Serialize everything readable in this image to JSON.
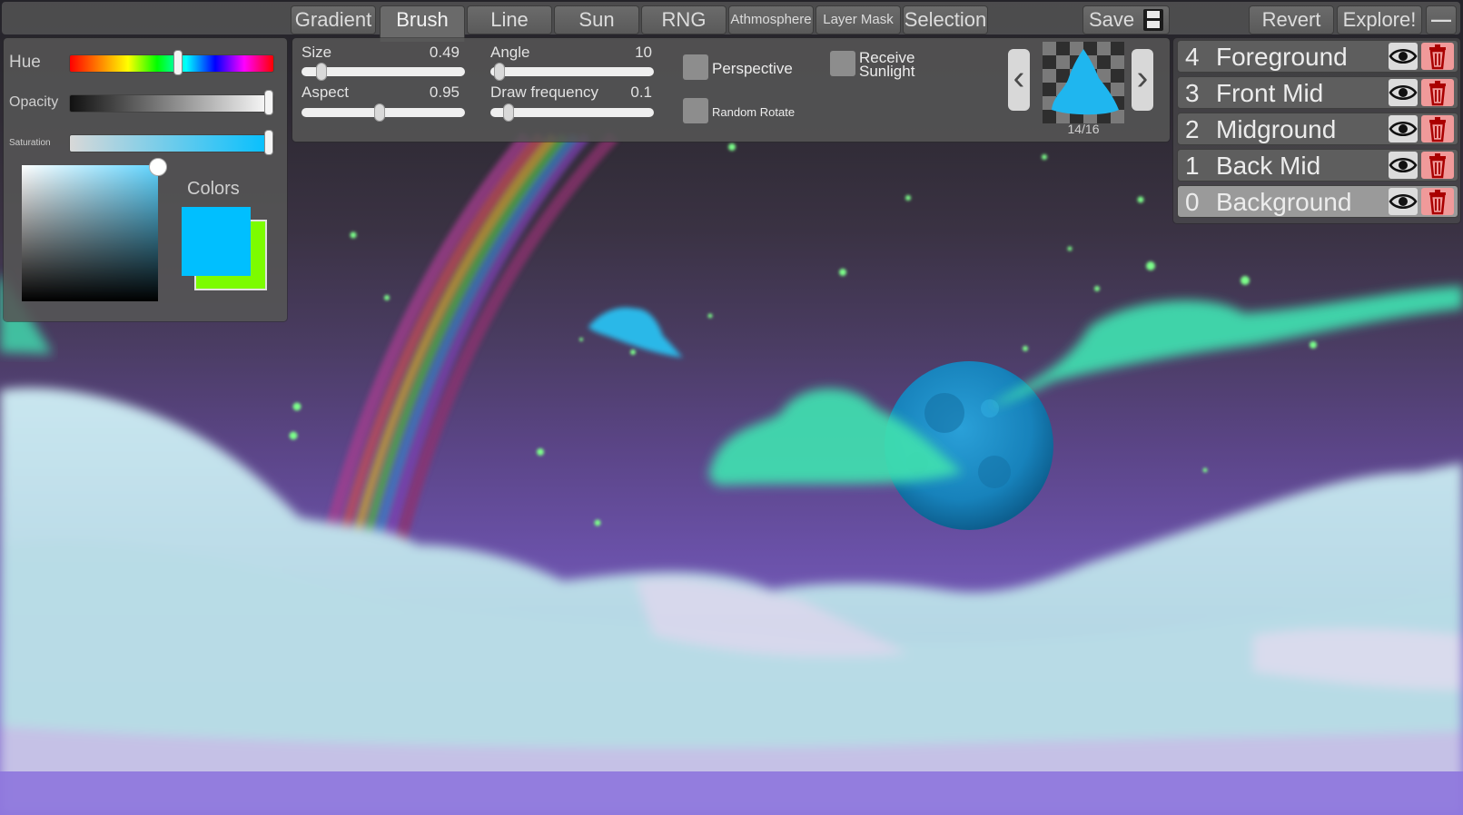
{
  "toolbar": {
    "tabs": [
      {
        "label": "Gradient"
      },
      {
        "label": "Brush"
      },
      {
        "label": "Line"
      },
      {
        "label": "Sun"
      },
      {
        "label": "RNG"
      },
      {
        "label": "Athmosphere"
      },
      {
        "label": "Layer Mask"
      },
      {
        "label": "Selection"
      }
    ],
    "save_label": "Save",
    "revert_label": "Revert",
    "explore_label": "Explore!",
    "minimize_label": "—"
  },
  "brush": {
    "size_label": "Size",
    "size_value": "0.49",
    "angle_label": "Angle",
    "angle_value": "10",
    "aspect_label": "Aspect",
    "aspect_value": "0.95",
    "freq_label": "Draw frequency",
    "freq_value": "0.1",
    "perspective_label": "Perspective",
    "receive_label": "Receive\nSunlight",
    "random_rotate_label": "Random Rotate",
    "brush_counter": "14/16",
    "prev_glyph": "‹",
    "next_glyph": "›"
  },
  "color_panel": {
    "hue_label": "Hue",
    "opacity_label": "Opacity",
    "saturation_label": "Saturation",
    "colors_label": "Colors",
    "primary_color": "#00bfff",
    "secondary_color": "#7cfc00"
  },
  "layers": [
    {
      "num": "4",
      "name": "Foreground"
    },
    {
      "num": "3",
      "name": "Front Mid"
    },
    {
      "num": "2",
      "name": "Midground"
    },
    {
      "num": "1",
      "name": "Back Mid"
    },
    {
      "num": "0",
      "name": "Background"
    }
  ]
}
